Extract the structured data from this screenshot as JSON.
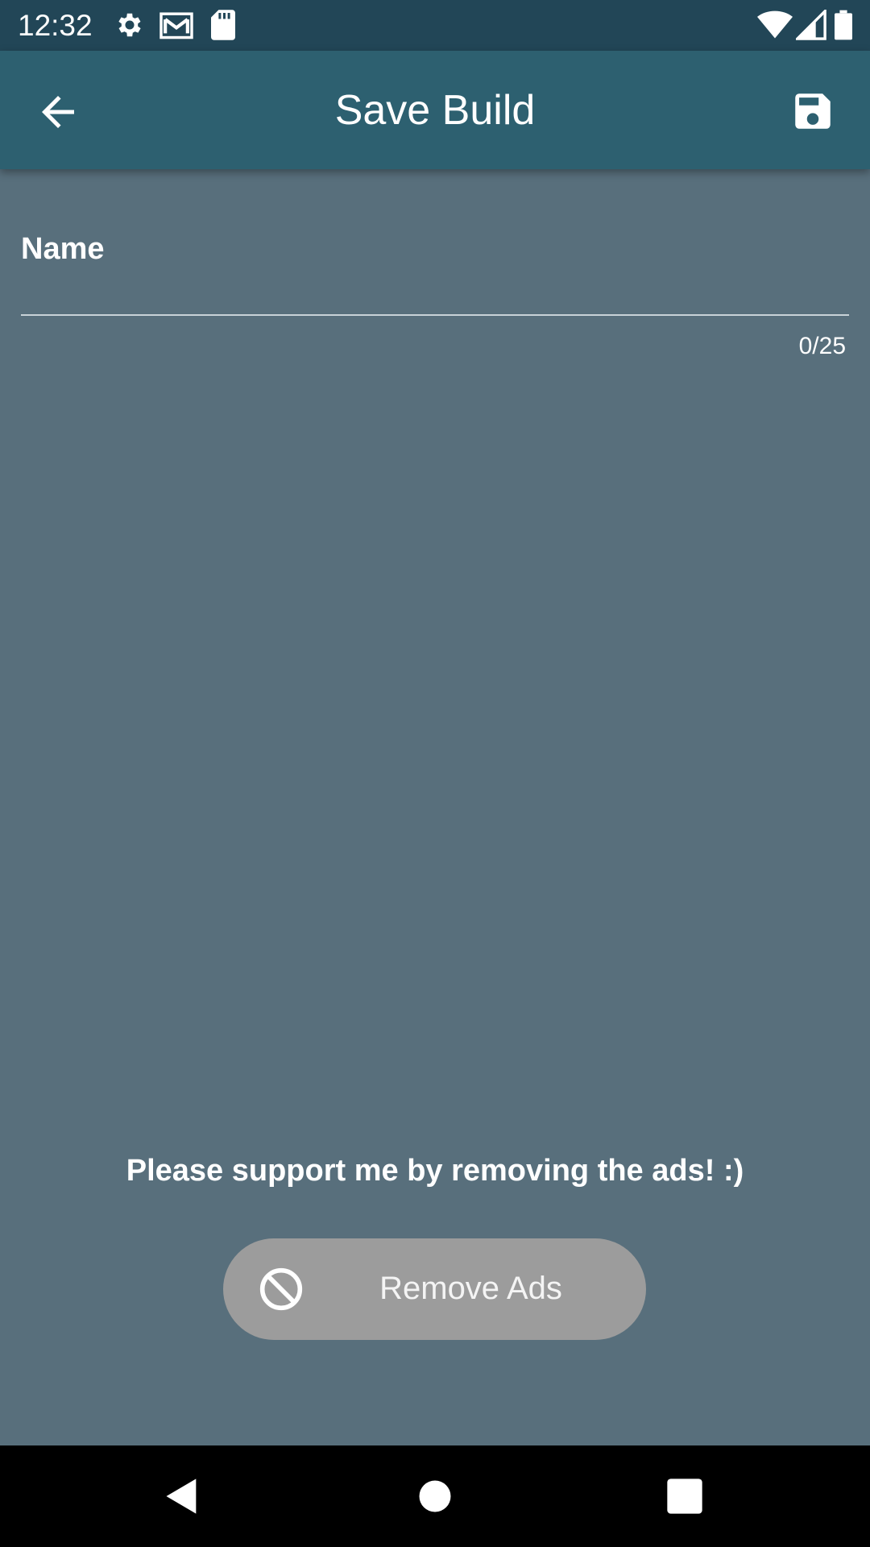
{
  "status_bar": {
    "time": "12:32",
    "icons": [
      "gear-icon",
      "gmail-icon",
      "sd-card-icon",
      "wifi-icon",
      "signal-icon",
      "battery-icon"
    ]
  },
  "app_bar": {
    "title": "Save Build",
    "back_icon": "arrow-back-icon",
    "save_icon": "floppy-disk-icon"
  },
  "form": {
    "name_label": "Name",
    "name_value": "",
    "counter": "0/25"
  },
  "support": {
    "message": "Please support me by removing the ads! :)",
    "remove_ads_label": "Remove Ads",
    "remove_ads_icon": "block-icon"
  },
  "nav_bar": {
    "icons": [
      "nav-back-icon",
      "nav-home-icon",
      "nav-recents-icon"
    ]
  },
  "colors": {
    "background": "#586f7c",
    "status_bar": "#224657",
    "app_bar": "#2d6070",
    "button": "#9c9c9c"
  }
}
